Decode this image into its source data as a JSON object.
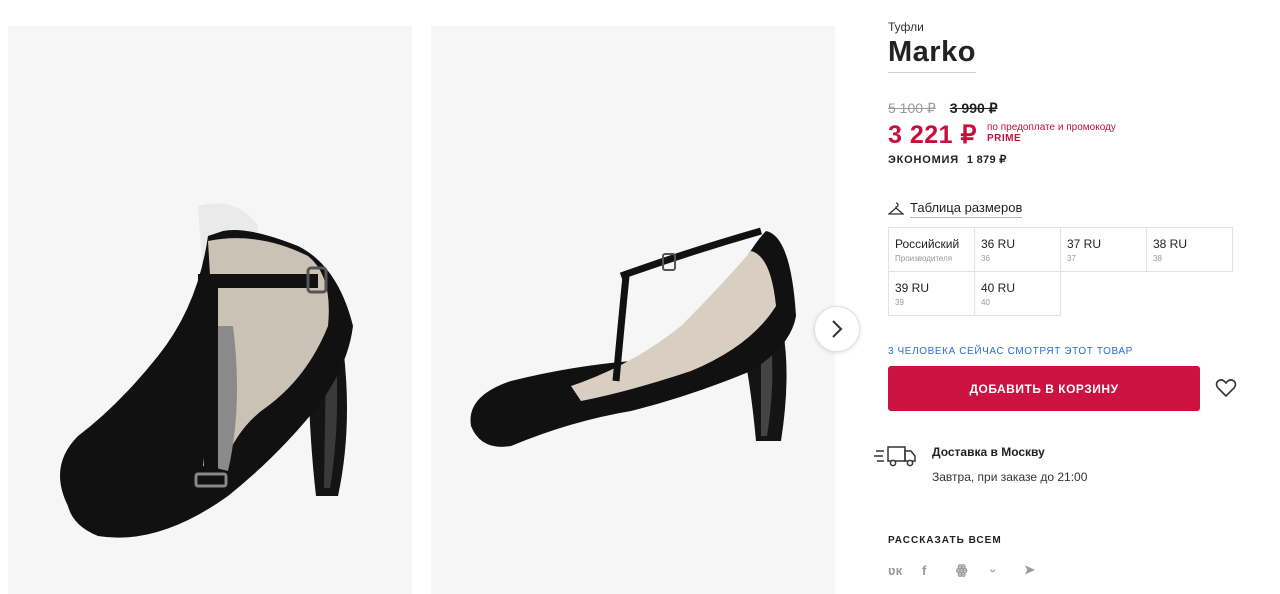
{
  "product": {
    "category": "Туфли",
    "brand": "Marko",
    "old_price": "5 100 ₽",
    "sale_price": "3 990 ₽",
    "price": "3 221 ₽",
    "promo_note": "по предоплате и промокоду",
    "promo_code": "PRIME",
    "saving_label": "ЭКОНОМИЯ",
    "saving_value": "1 879 ₽"
  },
  "sizes": {
    "table_link": "Таблица размеров",
    "header_main": "Российский",
    "header_sub": "Производителя",
    "items": [
      {
        "ru": "36 RU",
        "maker": "36"
      },
      {
        "ru": "37 RU",
        "maker": "37"
      },
      {
        "ru": "38 RU",
        "maker": "38"
      },
      {
        "ru": "39 RU",
        "maker": "39"
      },
      {
        "ru": "40 RU",
        "maker": "40"
      }
    ]
  },
  "viewers_note": "3 ЧЕЛОВЕКА СЕЙЧАС СМОТРЯТ ЭТОТ ТОВАР",
  "add_to_cart": "ДОБАВИТЬ В КОРЗИНУ",
  "delivery": {
    "title": "Доставка в Москву",
    "desc": "Завтра, при заказе до 21:00"
  },
  "share": {
    "title": "РАССКАЗАТЬ ВСЕМ",
    "networks": [
      {
        "icon": "vk-icon",
        "glyph": "ʋк"
      },
      {
        "icon": "facebook-icon",
        "glyph": "f"
      },
      {
        "icon": "odnoklassniki-icon",
        "glyph": "ꙮ"
      },
      {
        "icon": "moimir-icon",
        "glyph": "ᵕ"
      },
      {
        "icon": "twitter-icon",
        "glyph": "➤"
      }
    ]
  },
  "colors": {
    "accent": "#cb1240",
    "price": "#c5103b",
    "link": "#2b70c9"
  }
}
